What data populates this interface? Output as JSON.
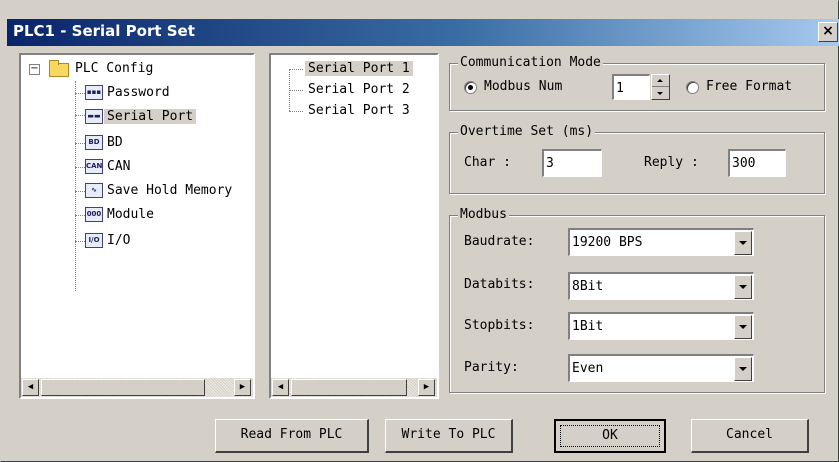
{
  "window": {
    "title": "PLC1 - Serial Port Set",
    "close_glyph": "×"
  },
  "config_tree": {
    "root": {
      "label": "PLC Config",
      "expander": "−",
      "icon": "folder-icon"
    },
    "children": [
      {
        "label": "Password",
        "icon": "password-icon",
        "icon_text": "▪▪▪"
      },
      {
        "label": "Serial Port",
        "icon": "serial-port-icon",
        "icon_text": "▬▬",
        "selected": true
      },
      {
        "label": "BD",
        "icon": "bd-icon",
        "icon_text": "BD"
      },
      {
        "label": "CAN",
        "icon": "can-icon",
        "icon_text": "CAN"
      },
      {
        "label": "Save Hold Memory",
        "icon": "save-hold-memory-icon",
        "icon_text": "∿"
      },
      {
        "label": "Module",
        "icon": "module-icon",
        "icon_text": "000"
      },
      {
        "label": "I/O",
        "icon": "io-icon",
        "icon_text": "I/O"
      }
    ]
  },
  "port_tree": {
    "items": [
      {
        "label": "Serial Port 1",
        "selected": true
      },
      {
        "label": "Serial Port 2"
      },
      {
        "label": "Serial Port 3"
      }
    ]
  },
  "scroll_glyphs": {
    "left": "◀",
    "right": "▶"
  },
  "communication_mode": {
    "legend": "Communication Mode",
    "modbus_label": "Modbus Num",
    "modbus_value": "1",
    "modbus_selected": true,
    "free_format_label": "Free Format"
  },
  "overtime": {
    "legend": "Overtime Set (ms)",
    "char_label": "Char :",
    "char_value": "3",
    "reply_label": "Reply :",
    "reply_value": "300"
  },
  "modbus": {
    "legend": "Modbus",
    "baudrate_label": "Baudrate:",
    "baudrate_value": "19200 BPS",
    "databits_label": "Databits:",
    "databits_value": "8Bit",
    "stopbits_label": "Stopbits:",
    "stopbits_value": "1Bit",
    "parity_label": "Parity:",
    "parity_value": "Even"
  },
  "buttons": {
    "read": "Read From PLC",
    "write": "Write To PLC",
    "ok": "OK",
    "cancel": "Cancel"
  },
  "colors": {
    "dialog_face": "#d4d0c8",
    "title_gradient_start": "#0a246a",
    "title_gradient_end": "#a6caf0",
    "title_text": "#ffffff"
  }
}
